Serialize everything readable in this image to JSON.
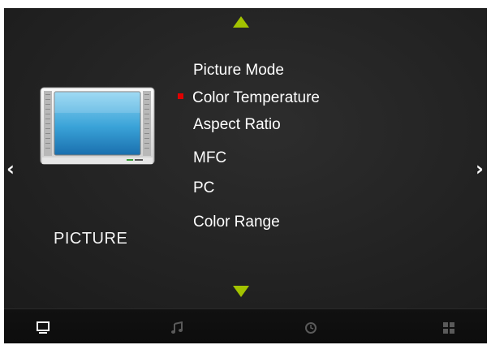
{
  "category": {
    "label": "PICTURE"
  },
  "menu": {
    "items": [
      {
        "label": "Picture Mode",
        "selected": false
      },
      {
        "label": "Color Temperature",
        "selected": true
      },
      {
        "label": "Aspect Ratio",
        "selected": false
      },
      {
        "label": "MFC",
        "selected": false
      },
      {
        "label": "PC",
        "selected": false
      },
      {
        "label": "Color Range",
        "selected": false
      }
    ]
  },
  "navigation": {
    "scroll_up_icon": "triangle-up",
    "scroll_down_icon": "triangle-down",
    "prev_icon": "chevron-left",
    "next_icon": "chevron-right",
    "left_glyph": "‹",
    "right_glyph": "›"
  },
  "bottom_nav": {
    "items": [
      {
        "name": "picture",
        "icon": "monitor-icon",
        "active": true
      },
      {
        "name": "sound",
        "icon": "music-note-icon",
        "active": false
      },
      {
        "name": "time",
        "icon": "clock-icon",
        "active": false
      },
      {
        "name": "setup",
        "icon": "grid-icon",
        "active": false
      }
    ]
  },
  "colors": {
    "accent_arrow": "#a3c300",
    "selection_marker": "#e00000",
    "text": "#ffffff",
    "background": "#222222"
  }
}
